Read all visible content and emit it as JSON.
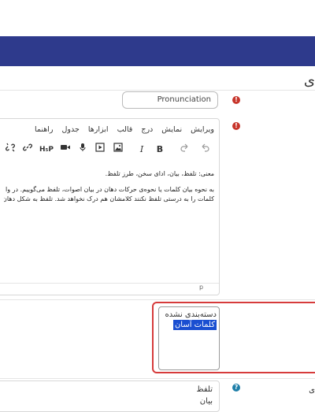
{
  "header": {
    "title_fragment": "ی"
  },
  "fields": {
    "name_input": {
      "value": "Pronunciation"
    },
    "editor": {
      "menu": [
        "ویرایش",
        "نمایش",
        "درج",
        "قالب",
        "ابزارها",
        "جدول",
        "راهنما"
      ],
      "toolbar_icons": [
        "undo-icon",
        "redo-icon",
        "bold-icon",
        "italic-icon",
        "image-icon",
        "media-icon",
        "microphone-icon",
        "video-icon",
        "h5p-icon",
        "link-icon",
        "unlink-icon"
      ],
      "bold_label": "B",
      "italic_label": "I",
      "h5p_label": "H₅P",
      "content": {
        "line1": "معنی: تلفظ، بیان، ادای سخن، طرز تلفظ.",
        "line2": "به نحوه بیان کلمات یا نحوه‌ی حرکات دهان در بیان اصوات، تلفظ می‌گوییم. در وا",
        "line3": "کلمات را به درستی تلفظ نکنند کلامشان هم درک نخواهد شد. تلفظ به شکل دهان،"
      },
      "status_path": "p"
    },
    "categories": {
      "options": [
        {
          "label": "دسته‌بندی نشده",
          "selected": false
        },
        {
          "label": "کلمات آسان",
          "selected": true
        }
      ]
    },
    "tags": {
      "items": [
        "تلفظ",
        "بیان"
      ]
    },
    "tags_side_label": "ی"
  },
  "colors": {
    "navbar": "#2e3a8c",
    "required": "#c7352b",
    "help": "#1e7ea8",
    "highlight": "#d63b3b",
    "selection": "#1a4fd1"
  }
}
